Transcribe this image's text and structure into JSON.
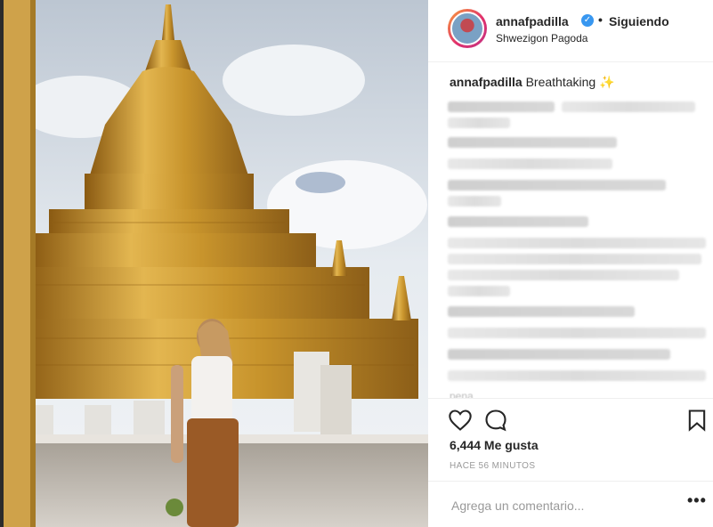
{
  "post": {
    "username": "annafpadilla",
    "follow_state": "Siguiendo",
    "location": "Shwezigon Pagoda",
    "caption_user": "annafpadilla",
    "caption_text": "Breathtaking",
    "caption_emoji": "✨",
    "partial_comment_text": "pena",
    "likes": "6,444 Me gusta",
    "time": "HACE 56 MINUTOS",
    "comment_placeholder": "Agrega un comentario..."
  },
  "icons": {
    "verified": "verified-badge-icon",
    "like": "heart-icon",
    "comment": "comment-bubble-icon",
    "save": "bookmark-icon",
    "more": "more-options-icon"
  },
  "colors": {
    "verified_blue": "#3897f0",
    "gold": "#c9982e",
    "text": "#262626",
    "muted": "#999999"
  }
}
